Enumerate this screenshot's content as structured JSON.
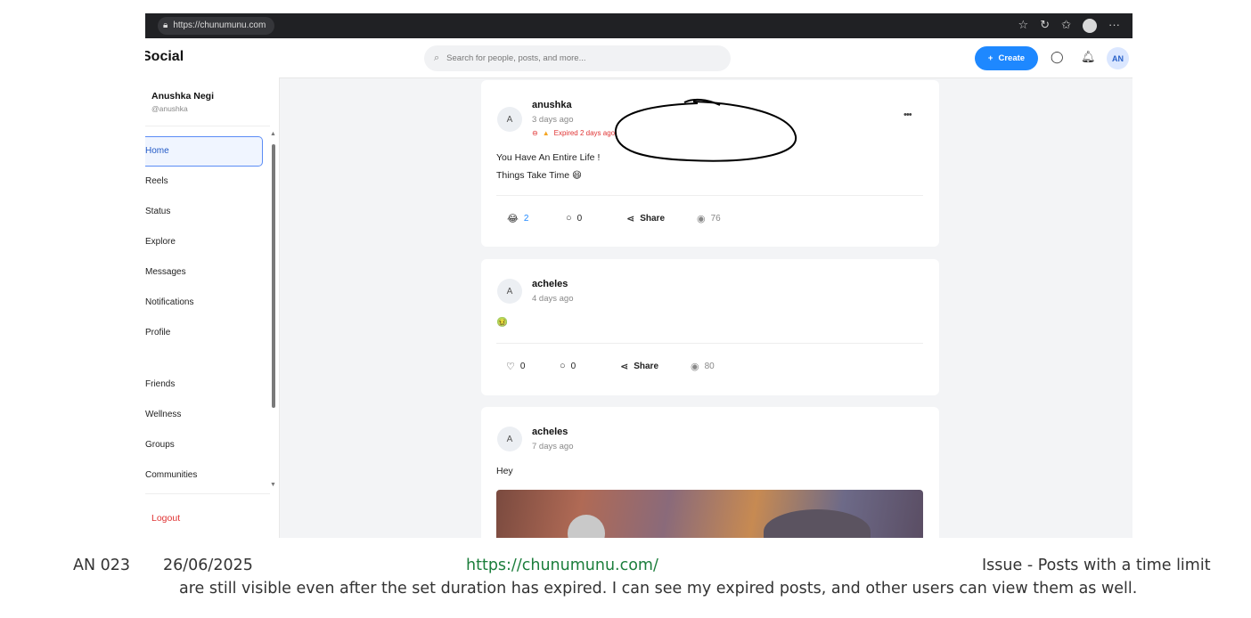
{
  "browser": {
    "url": "https://chunumunu.com",
    "icons": [
      "star-icon",
      "refresh-icon",
      "favorites-icon",
      "profile-icon",
      "more-icon"
    ]
  },
  "header": {
    "logo": "Social",
    "search_placeholder": "Search for people, posts, and more...",
    "create_label": "Create",
    "avatar_initials": "AN"
  },
  "sidebar": {
    "user_name": "Anushka Negi",
    "user_handle": "@anushka",
    "items": [
      {
        "label": "Home",
        "active": true
      },
      {
        "label": "Reels"
      },
      {
        "label": "Status"
      },
      {
        "label": "Explore"
      },
      {
        "label": "Messages"
      },
      {
        "label": "Notifications"
      },
      {
        "label": "Profile"
      },
      {
        "label": "Friends"
      },
      {
        "label": "Wellness"
      },
      {
        "label": "Groups"
      },
      {
        "label": "Communities"
      }
    ],
    "logout": "Logout"
  },
  "posts": [
    {
      "avatar": "A",
      "author": "anushka",
      "time": "3 days ago",
      "expired_label": "Expired 2 days ago",
      "lines": [
        "You Have An Entire Life !",
        "Things Take Time 😄"
      ],
      "reactions": "2",
      "comments": "0",
      "share": "Share",
      "views": "76"
    },
    {
      "avatar": "A",
      "author": "acheles",
      "time": "4 days ago",
      "lines": [
        "🤢"
      ],
      "likes": "0",
      "comments": "0",
      "share": "Share",
      "views": "80"
    },
    {
      "avatar": "A",
      "author": "acheles",
      "time": "7 days ago",
      "lines": [
        "Hey"
      ]
    }
  ],
  "caption": {
    "id": "AN 023",
    "date": "26/06/2025",
    "link": "https://chunumunu.com/",
    "issue_line1": "Issue - Posts with a time limit",
    "issue_line2": "are still visible even after the set duration has expired. I can see my expired posts, and other users can view them as well."
  },
  "colors": {
    "accent": "#1e88ff",
    "expired": "#e03434",
    "link": "#1c7e3c",
    "annotation": "#000000"
  }
}
